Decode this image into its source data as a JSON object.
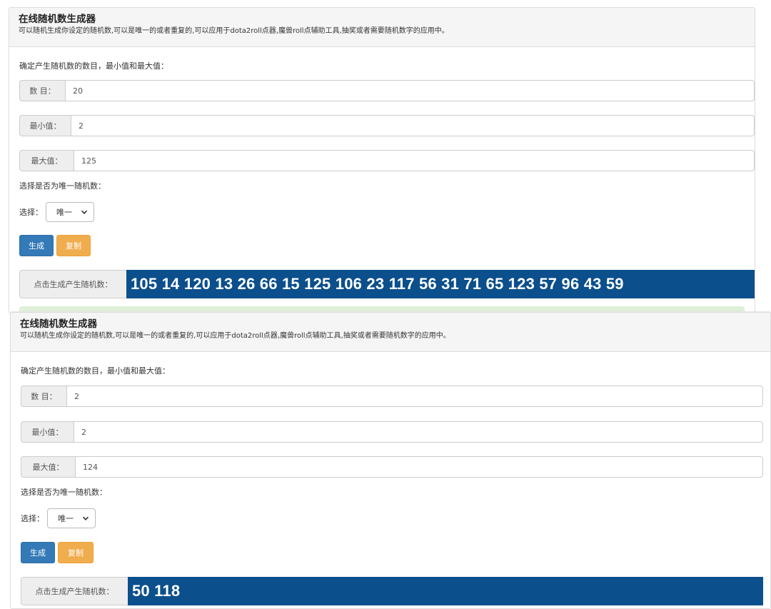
{
  "panels": [
    {
      "title": "在线随机数生成器",
      "description": "可以随机生成你设定的随机数,可以是唯一的或者重复的,可以应用于dota2roll点器,魔兽roll点辅助工具,抽奖或者需要随机数字的应用中。",
      "prompt": "确定产生随机数的数目，最小值和最大值：",
      "count_label": "数 目：",
      "count_value": "20",
      "min_label": "最小值：",
      "min_value": "2",
      "max_label": "最大值：",
      "max_value": "125",
      "unique_prompt": "选择是否为唯一随机数：",
      "select_label": "选择：",
      "select_value": "唯一",
      "generate_label": "生成",
      "copy_label": "复制",
      "result_label": "点击生成产生随机数：",
      "result_value": "105 14 120 13 26 66 15 125 106 23 117 56 31 71 65 123 57 96 43 59"
    },
    {
      "title": "在线随机数生成器",
      "description": "可以随机生成你设定的随机数,可以是唯一的或者重复的,可以应用于dota2roll点器,魔兽roll点辅助工具,抽奖或者需要随机数字的应用中。",
      "prompt": "确定产生随机数的数目，最小值和最大值：",
      "count_label": "数 目：",
      "count_value": "2",
      "min_label": "最小值：",
      "min_value": "2",
      "max_label": "最大值：",
      "max_value": "124",
      "unique_prompt": "选择是否为唯一随机数：",
      "select_label": "选择：",
      "select_value": "唯一",
      "generate_label": "生成",
      "copy_label": "复制",
      "result_label": "点击生成产生随机数：",
      "result_value": "50 118"
    }
  ],
  "icons": {
    "select_arrow": "chevron-down-icon"
  },
  "colors": {
    "primary": "#337ab7",
    "warning": "#f0ad4e",
    "result_bg": "#0b4f8c",
    "success_bg": "#dff0d8"
  }
}
